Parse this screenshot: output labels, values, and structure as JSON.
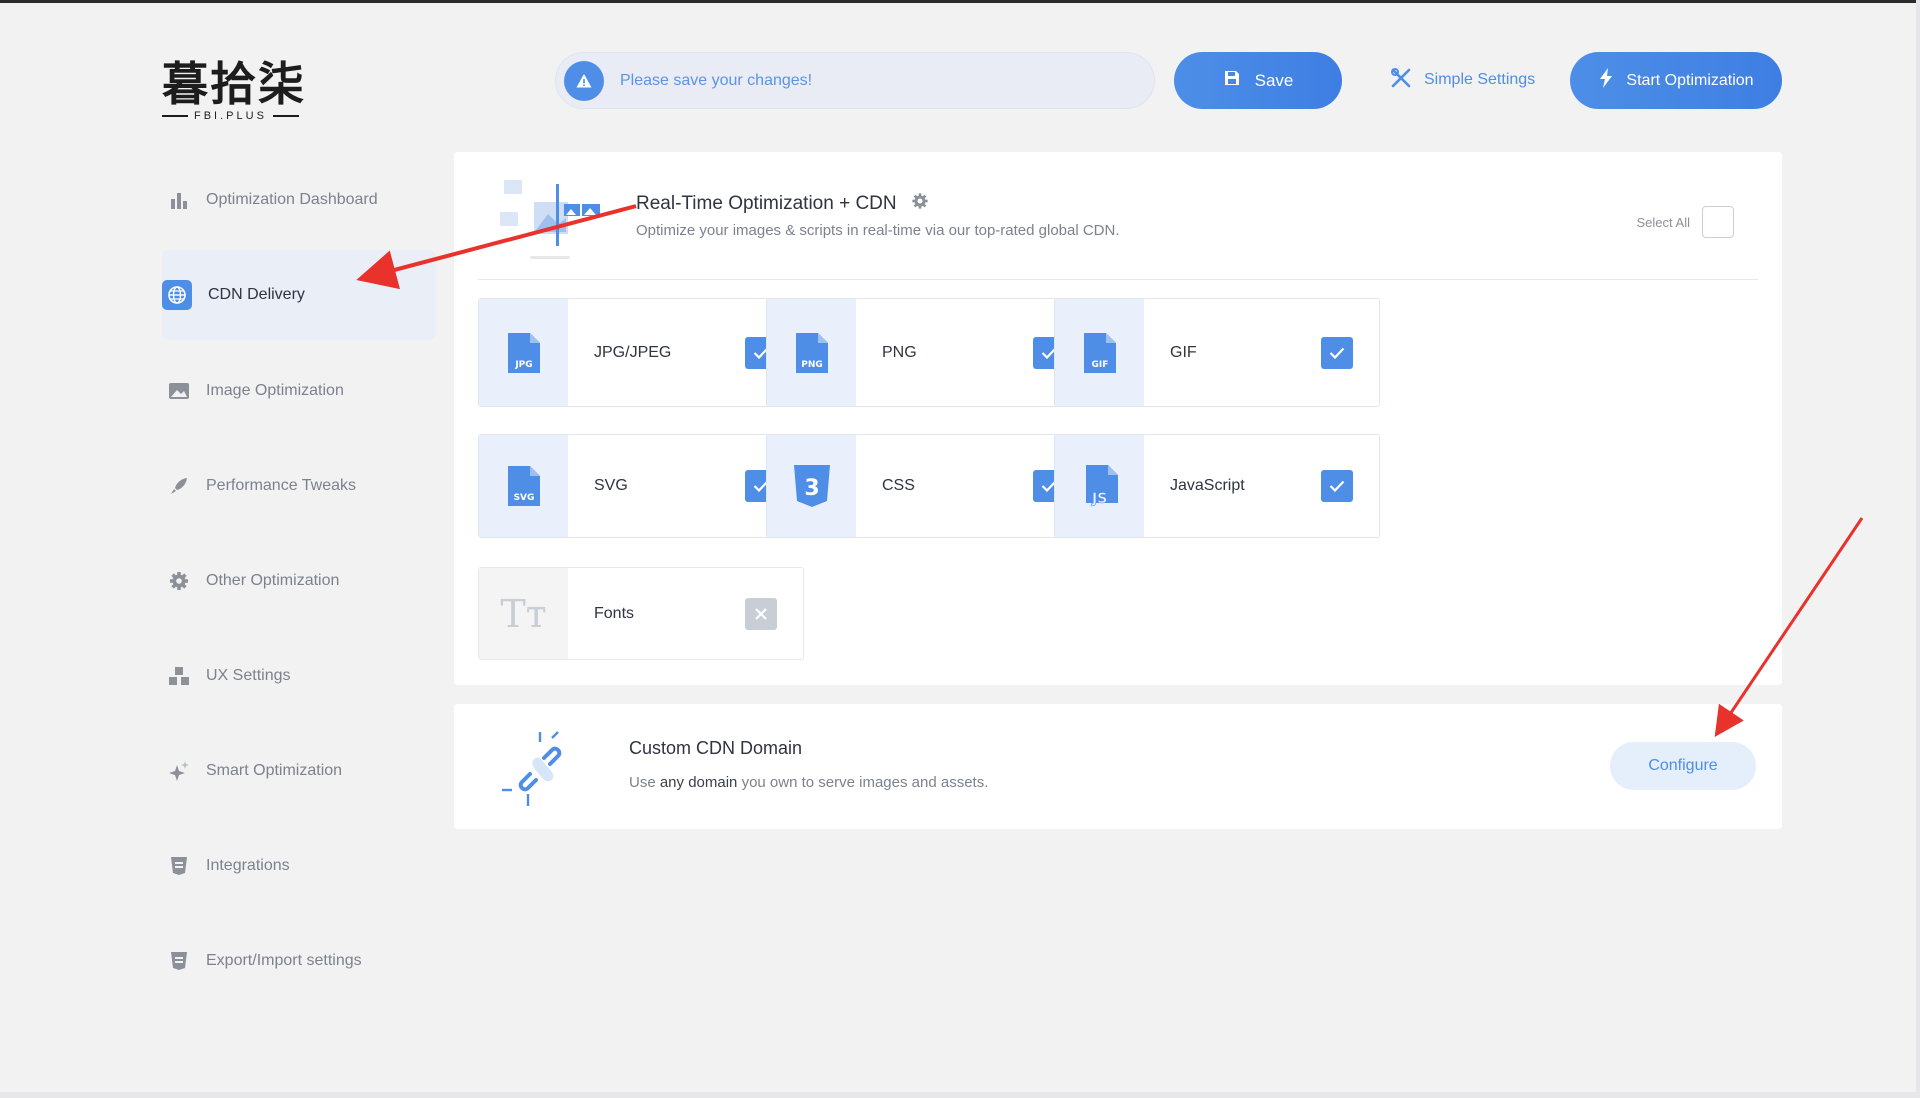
{
  "brand": {
    "logo_main": "暮拾柒",
    "logo_sub": "FBI.PLUS"
  },
  "topbar": {
    "alert_text": "Please save your changes!",
    "save_label": "Save",
    "simple_settings_label": "Simple Settings",
    "start_label": "Start Optimization"
  },
  "sidebar": {
    "items": [
      {
        "label": "Optimization Dashboard",
        "icon": "bar-chart-icon"
      },
      {
        "label": "CDN Delivery",
        "icon": "globe-icon",
        "active": true
      },
      {
        "label": "Image Optimization",
        "icon": "image-icon"
      },
      {
        "label": "Performance Tweaks",
        "icon": "rocket-icon"
      },
      {
        "label": "Other Optimization",
        "icon": "gear-icon"
      },
      {
        "label": "UX Settings",
        "icon": "cubes-icon"
      },
      {
        "label": "Smart Optimization",
        "icon": "sparkle-icon"
      },
      {
        "label": "Integrations",
        "icon": "shield-icon"
      },
      {
        "label": "Export/Import settings",
        "icon": "shield-icon"
      }
    ]
  },
  "cdn_card": {
    "title": "Real-Time Optimization + CDN",
    "subtitle": "Optimize your images & scripts in real-time via our top-rated global CDN.",
    "select_all_label": "Select All",
    "tiles": [
      {
        "label": "JPG/JPEG",
        "icon_text": "JPG",
        "checked": true
      },
      {
        "label": "PNG",
        "icon_text": "PNG",
        "checked": true
      },
      {
        "label": "GIF",
        "icon_text": "GIF",
        "checked": true
      },
      {
        "label": "SVG",
        "icon_text": "SVG",
        "checked": true
      },
      {
        "label": "CSS",
        "icon_text": "3",
        "checked": true
      },
      {
        "label": "JavaScript",
        "icon_text": "JS",
        "checked": true
      },
      {
        "label": "Fonts",
        "icon_text": "Tт",
        "checked": false
      }
    ]
  },
  "domain_card": {
    "title": "Custom CDN Domain",
    "subtitle_pre": "Use ",
    "subtitle_bold": "any domain",
    "subtitle_post": " you own to serve images and assets.",
    "configure_label": "Configure"
  },
  "colors": {
    "accent": "#4f8ee6",
    "annotation": "#e8322b"
  }
}
